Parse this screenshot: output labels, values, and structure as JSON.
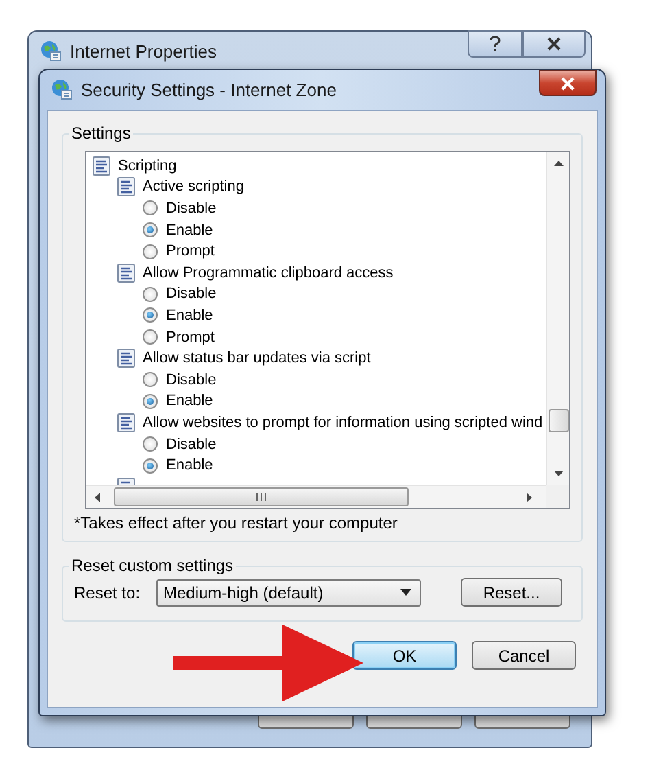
{
  "back_window": {
    "title": "Internet Properties"
  },
  "dialog": {
    "title": "Security Settings - Internet Zone",
    "settings": {
      "label": "Settings",
      "tree": [
        {
          "kind": "group",
          "label": "Scripting",
          "children": [
            {
              "kind": "setting",
              "label": "Active scripting",
              "children": [
                {
                  "kind": "option",
                  "label": "Disable",
                  "selected": false
                },
                {
                  "kind": "option",
                  "label": "Enable",
                  "selected": true
                },
                {
                  "kind": "option",
                  "label": "Prompt",
                  "selected": false
                }
              ]
            },
            {
              "kind": "setting",
              "label": "Allow Programmatic clipboard access",
              "children": [
                {
                  "kind": "option",
                  "label": "Disable",
                  "selected": false
                },
                {
                  "kind": "option",
                  "label": "Enable",
                  "selected": true
                },
                {
                  "kind": "option",
                  "label": "Prompt",
                  "selected": false
                }
              ]
            },
            {
              "kind": "setting",
              "label": "Allow status bar updates via script",
              "children": [
                {
                  "kind": "option",
                  "label": "Disable",
                  "selected": false
                },
                {
                  "kind": "option",
                  "label": "Enable",
                  "selected": true
                }
              ]
            },
            {
              "kind": "setting",
              "label": "Allow websites to prompt for information using scripted wind",
              "children": [
                {
                  "kind": "option",
                  "label": "Disable",
                  "selected": false
                },
                {
                  "kind": "option",
                  "label": "Enable",
                  "selected": true
                }
              ]
            },
            {
              "kind": "setting"
            }
          ]
        }
      ]
    },
    "note": "*Takes effect after you restart your computer",
    "reset": {
      "label": "Reset custom settings",
      "reset_to_label": "Reset to:",
      "level": "Medium-high (default)",
      "button": "Reset..."
    },
    "buttons": [
      {
        "label": "OK",
        "default": true
      },
      {
        "label": "Cancel",
        "default": false
      }
    ]
  }
}
